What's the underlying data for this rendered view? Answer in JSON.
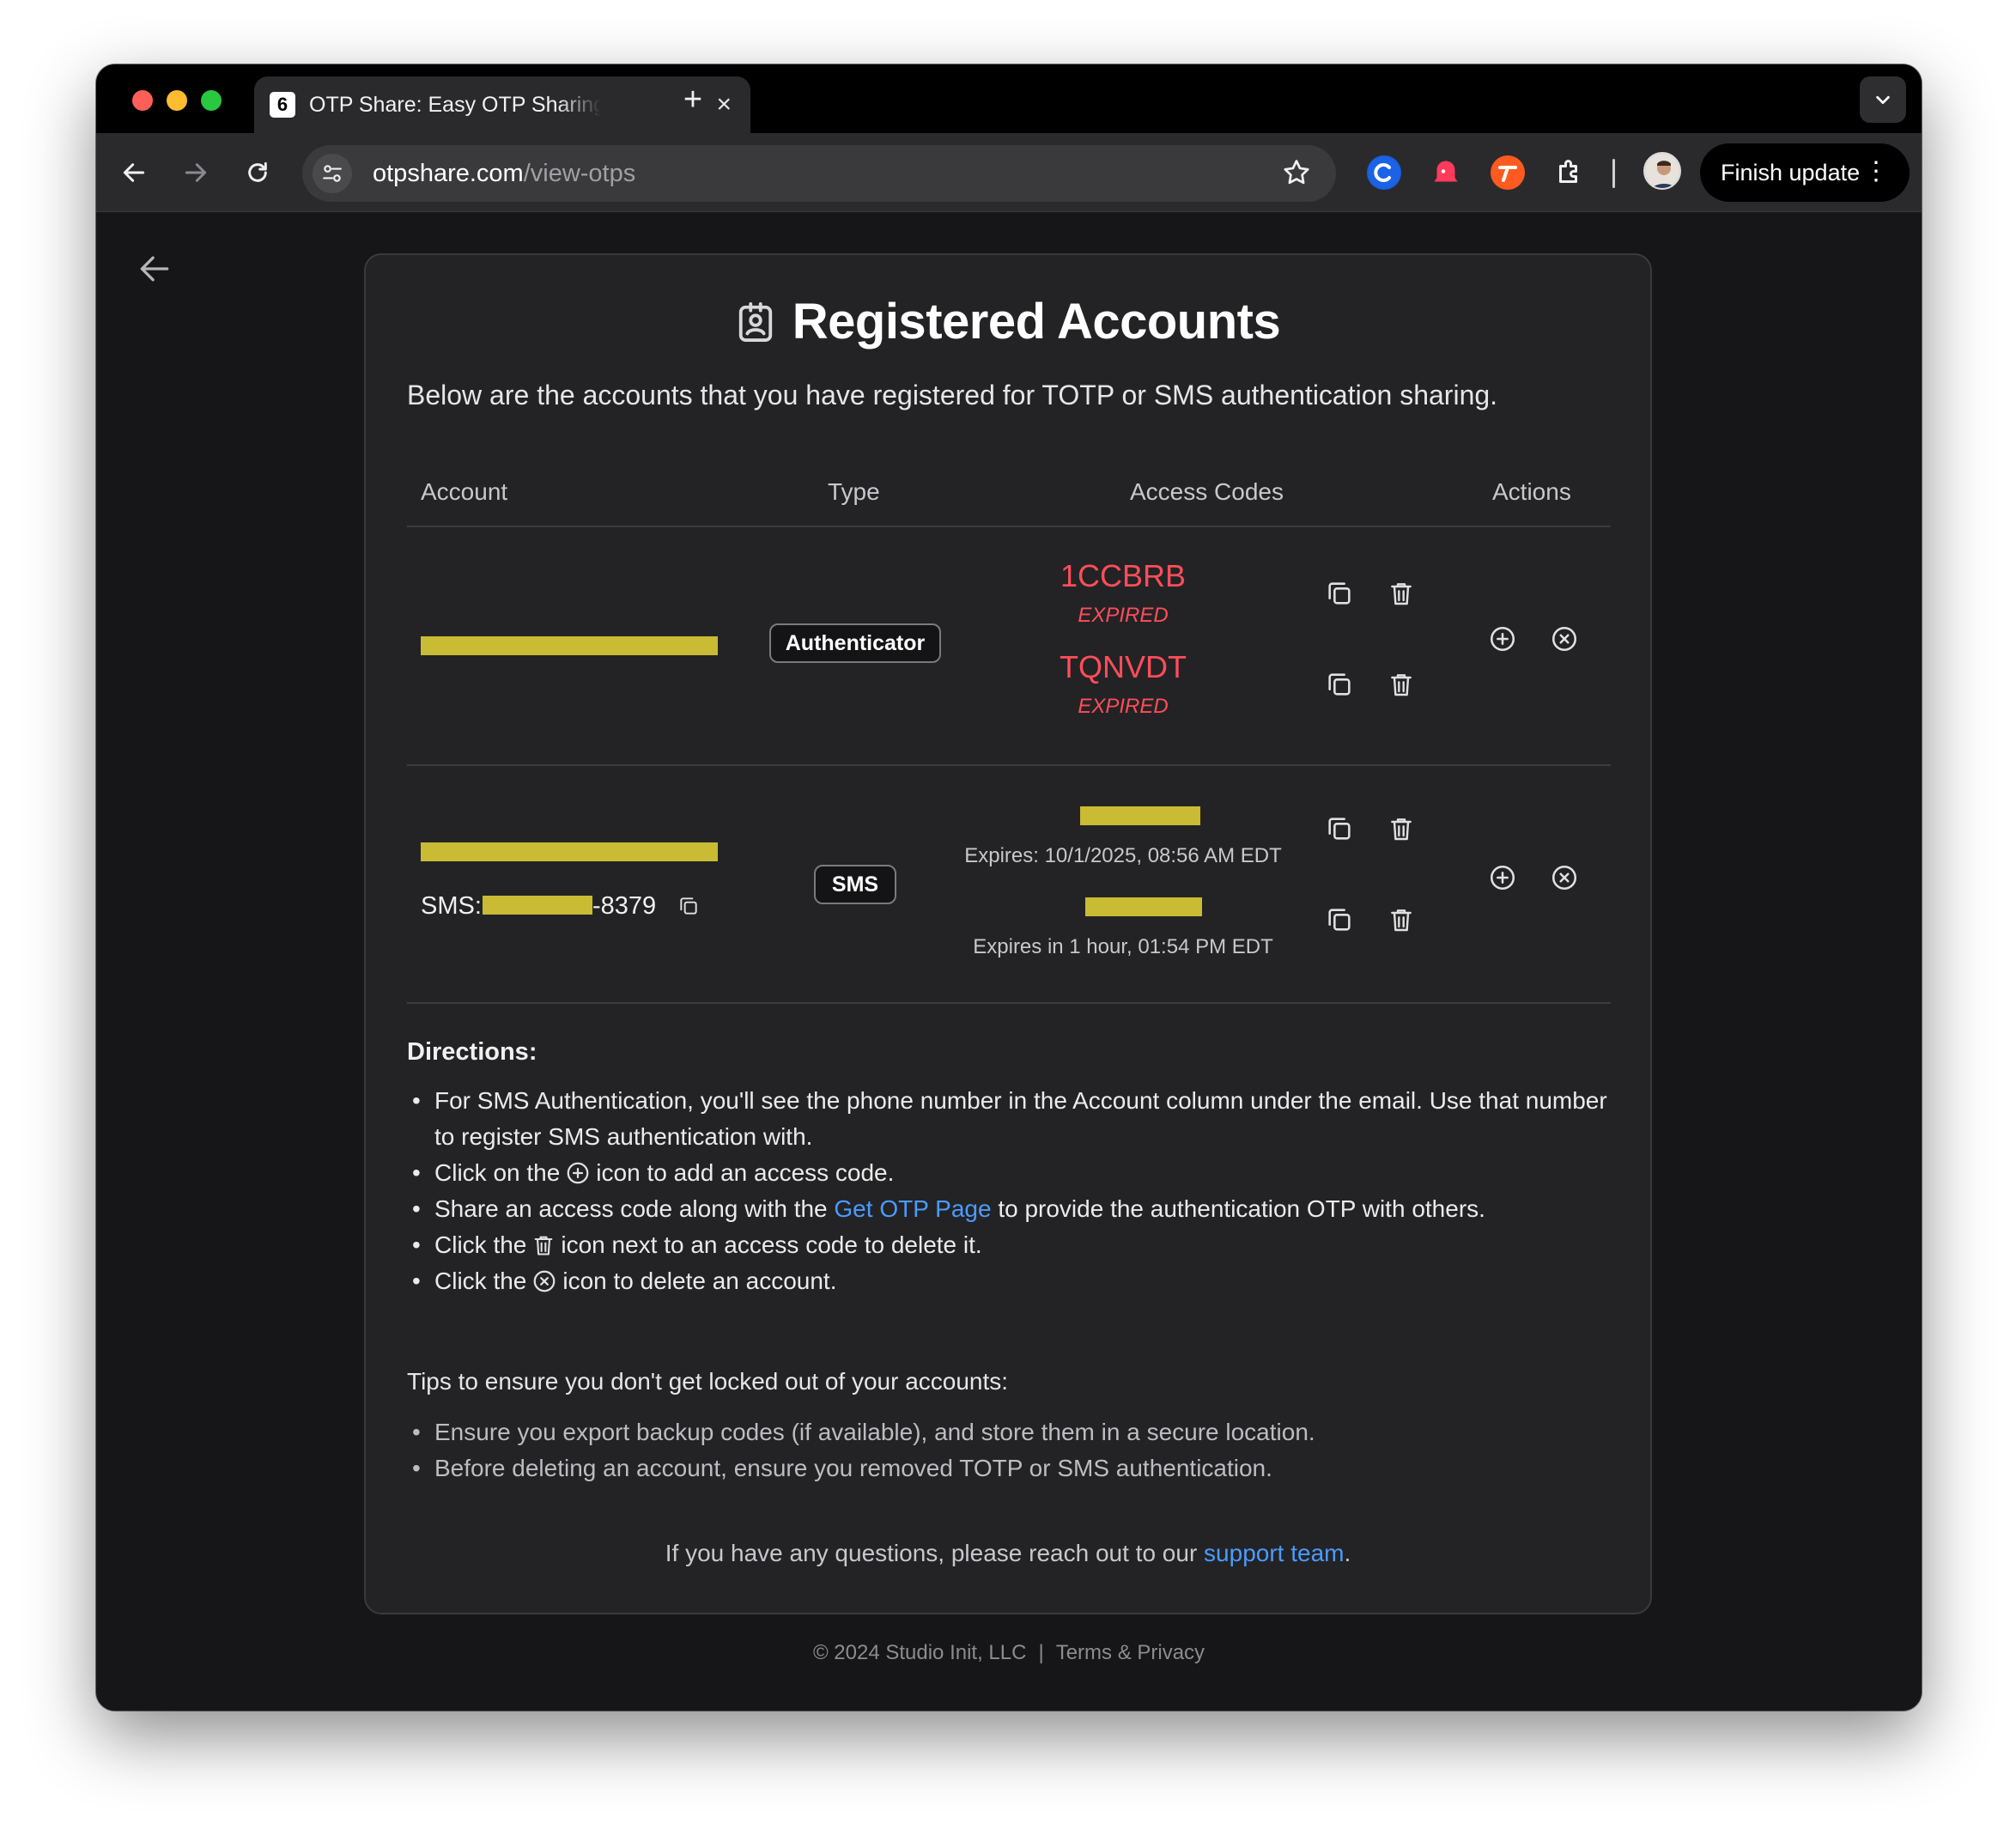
{
  "browser": {
    "tab_title": "OTP Share: Easy OTP Sharing",
    "tab_favicon": "6",
    "tab_close": "×",
    "new_tab": "+",
    "url_host": "otpshare.com",
    "url_path": "/view-otps",
    "finish_update": "Finish update",
    "menu_dots": "⋮"
  },
  "page": {
    "title": "Registered Accounts",
    "subtitle": "Below are the accounts that you have registered for TOTP or SMS authentication sharing.",
    "columns": [
      "Account",
      "Type",
      "Access Codes",
      "Actions"
    ],
    "accounts": [
      {
        "type": "Authenticator",
        "codes": [
          {
            "code": "1CCBRB",
            "status": "EXPIRED"
          },
          {
            "code": "TQNVDT",
            "status": "EXPIRED"
          }
        ]
      },
      {
        "type": "SMS",
        "sms_prefix": "SMS:",
        "sms_suffix": "-8379",
        "codes": [
          {
            "status": "Expires: 10/1/2025, 08:56 AM EDT"
          },
          {
            "status": "Expires in 1 hour, 01:54 PM EDT"
          }
        ]
      }
    ],
    "directions_title": "Directions:",
    "directions": {
      "d1": "For SMS Authentication, you'll see the phone number in the Account column under the email. Use that number to register SMS authentication with.",
      "d2_pre": "Click on the",
      "d2_post": "icon to add an access code.",
      "d3_pre": "Share an access code along with the",
      "d3_link": "Get OTP Page",
      "d3_post": "to provide the authentication OTP with others.",
      "d4_pre": "Click the",
      "d4_post": "icon next to an access code to delete it.",
      "d5_pre": "Click the",
      "d5_post": "icon to delete an account."
    },
    "tips_title": "Tips to ensure you don't get locked out of your accounts:",
    "tips": [
      "Ensure you export backup codes (if available), and store them in a secure location.",
      "Before deleting an account, ensure you removed TOTP or SMS authentication."
    ],
    "questions_pre": "If you have any questions, please reach out to our",
    "questions_link": "support team",
    "questions_post": "."
  },
  "footer": {
    "copyright": "© 2024 Studio Init, LLC",
    "separator": "|",
    "terms": "Terms & Privacy"
  },
  "colors": {
    "accent_link": "#4b9bff",
    "expired_red": "#ff4d5a",
    "redaction": "#c9bb33"
  }
}
